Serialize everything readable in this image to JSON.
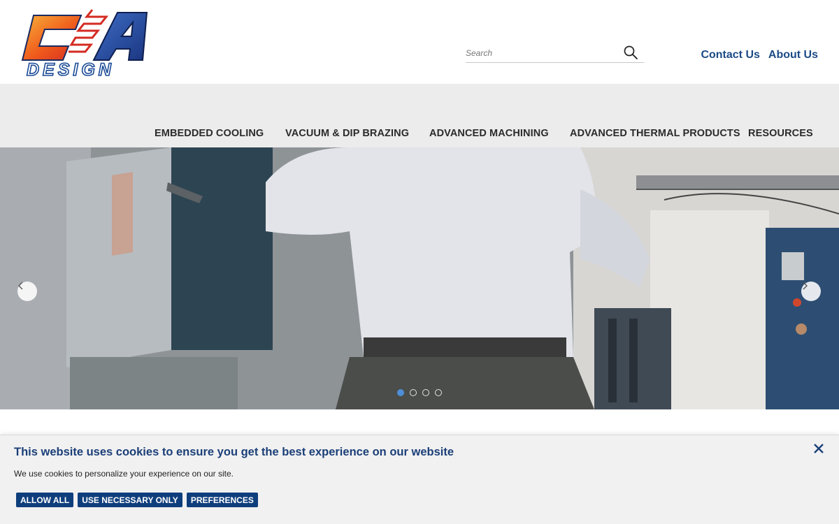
{
  "brand": {
    "logo_text_top": "CA",
    "logo_text_bottom": "DESIGN"
  },
  "search": {
    "placeholder": "Search"
  },
  "top_links": {
    "contact": "Contact Us",
    "about": "About Us"
  },
  "nav": {
    "items": [
      {
        "label": "EMBEDDED COOLING"
      },
      {
        "label": "VACUUM & DIP BRAZING"
      },
      {
        "label": "ADVANCED MACHINING"
      },
      {
        "label": "ADVANCED THERMAL PRODUCTS"
      },
      {
        "label": "RESOURCES"
      }
    ]
  },
  "hero": {
    "prev_icon": "chevron-left-icon",
    "next_icon": "chevron-right-icon",
    "slide_count": 4,
    "active_slide": 1
  },
  "cookie": {
    "title": "This website uses cookies to ensure you get the best experience on our website",
    "text": "We use cookies to personalize your experience on our site.",
    "buttons": {
      "allow_all": "ALLOW ALL",
      "necessary": "USE NECESSARY ONLY",
      "preferences": "PREFERENCES"
    },
    "close_icon": "close-icon"
  },
  "colors": {
    "link_blue": "#1b4a86",
    "button_blue": "#0f3e7c",
    "nav_band": "#ececec",
    "dot_active": "#4f8fd8"
  }
}
